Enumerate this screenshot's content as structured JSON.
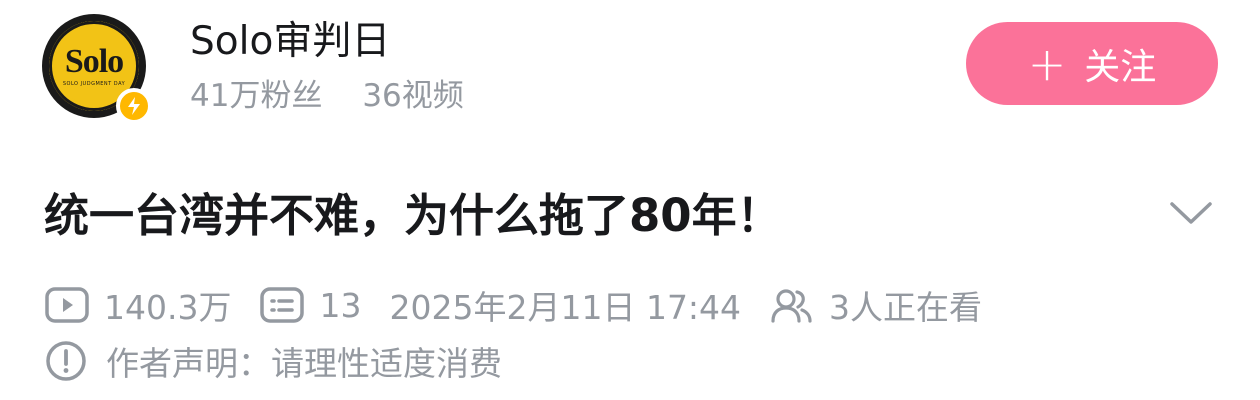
{
  "author": {
    "name": "Solo审判日",
    "avatar_text": "Solo",
    "avatar_subtext": "SOLO JUDGMENT DAY",
    "verified_icon": "lightning-icon",
    "followers": "41万粉丝",
    "videos": "36视频"
  },
  "follow_button": {
    "plus": "+",
    "label": "关注"
  },
  "video": {
    "title": "统一台湾并不难，为什么拖了80年！",
    "expand_icon": "chevron-down-icon",
    "play_count": "140.3万",
    "comment_count": "13",
    "publish_time": "2025年2月11日 17:44",
    "watching": "3人正在看"
  },
  "declaration": {
    "text": "作者声明：请理性适度消费"
  },
  "colors": {
    "follow_bg": "#fb7299",
    "muted": "#9499a0",
    "badge": "#ffb800"
  }
}
